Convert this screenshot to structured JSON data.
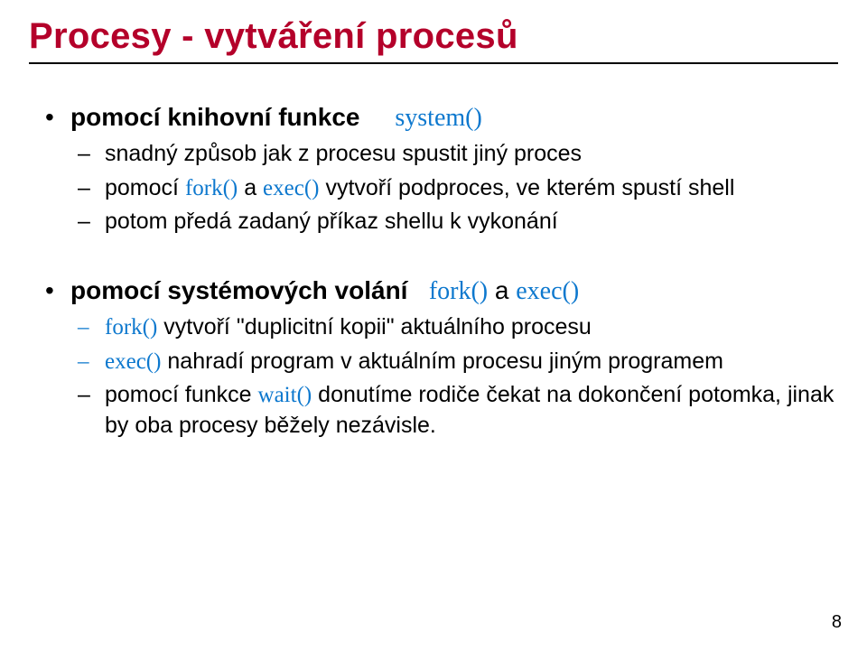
{
  "title": "Procesy - vytváření procesů",
  "bullets": {
    "b1_prefix": "pomocí knihovní funkce",
    "b1_code": "system()",
    "b1_sub1": "snadný způsob jak z procesu spustit jiný proces",
    "b1_sub2_prefix": "pomocí ",
    "b1_sub2_code1": "fork()",
    "b1_sub2_mid": " a ",
    "b1_sub2_code2": "exec()",
    "b1_sub2_suffix": " vytvoří podproces, ve kterém spustí shell",
    "b1_sub3": "potom předá zadaný příkaz shellu k vykonání",
    "b2_prefix": "pomocí systémových volání",
    "b2_code1": "fork()",
    "b2_mid": " a ",
    "b2_code2": "exec()",
    "b2_sub1_code": "fork()",
    "b2_sub1_text": " vytvoří \"duplicitní kopii\" aktuálního procesu",
    "b2_sub2_code": "exec()",
    "b2_sub2_text": " nahradí program v aktuálním procesu jiným programem",
    "b2_sub3_prefix": "pomocí funkce ",
    "b2_sub3_code": "wait()",
    "b2_sub3_suffix": " donutíme rodiče čekat na dokončení potomka, jinak by oba procesy běžely nezávisle."
  },
  "page_number": "8"
}
